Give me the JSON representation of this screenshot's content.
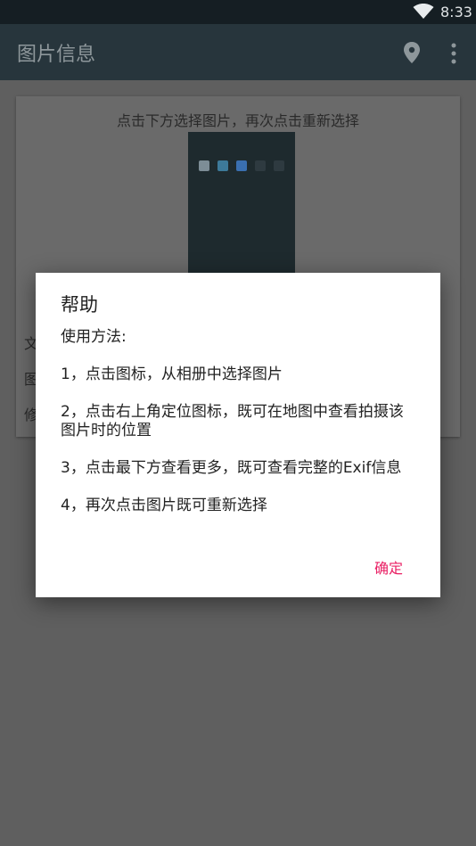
{
  "status_bar": {
    "time": "8:33",
    "wifi_icon": "wifi-icon"
  },
  "app_bar": {
    "title": "图片信息",
    "location_icon": "location-pin-icon",
    "more_icon": "more-vert-icon"
  },
  "card": {
    "hint": "点击下方选择图片，再次点击重新选择",
    "row_labels": [
      "文",
      "图",
      "修"
    ]
  },
  "dialog": {
    "title": "帮助",
    "usage_heading": "使用方法:",
    "steps": [
      "1，点击图标，从相册中选择图片",
      "2，点击右上角定位图标，既可在地图中查看拍摄该图片时的位置",
      "3，点击最下方查看更多，既可查看完整的Exif信息",
      "4，再次点击图片既可重新选择"
    ],
    "ok_label": "确定"
  },
  "colors": {
    "app_bar": "#27353c",
    "status_bar": "#151e23",
    "accent": "#e91e63",
    "scrim_background": "#5f5f5f"
  }
}
